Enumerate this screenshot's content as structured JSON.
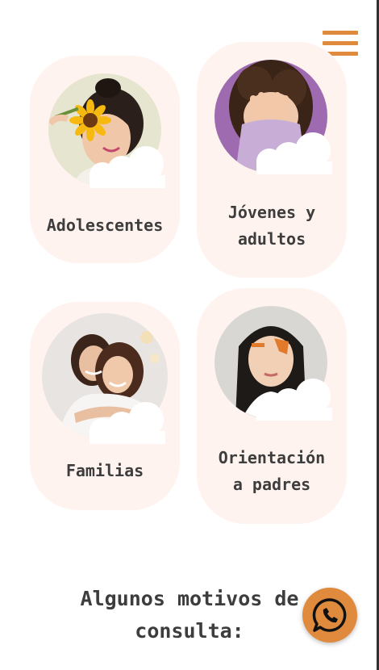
{
  "header": {
    "menu_icon": "hamburger-menu-icon",
    "accent_color": "#e08a3e"
  },
  "cards": [
    {
      "label": "Adolescentes",
      "photo": "teen-with-sunflower-photo"
    },
    {
      "label_line1": "Jóvenes y",
      "label_line2": "adultos",
      "photo": "person-covering-face-photo"
    },
    {
      "label": "Familias",
      "photo": "mother-and-daughter-photo"
    },
    {
      "label_line1": "Orientación",
      "label_line2": "a padres",
      "photo": "girl-with-face-paint-photo"
    }
  ],
  "section": {
    "title_line1": "Algunos motivos de",
    "title_line2": "consulta:"
  },
  "whatsapp": {
    "icon": "whatsapp-icon"
  }
}
